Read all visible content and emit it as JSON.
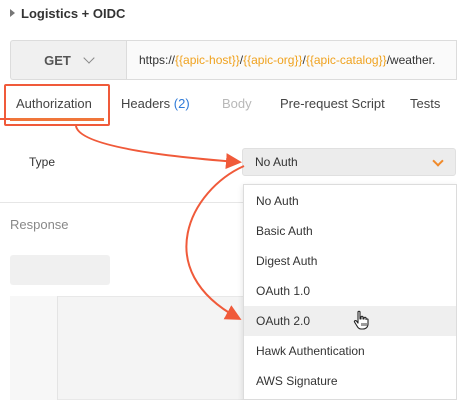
{
  "collection": {
    "title": "Logistics + OIDC"
  },
  "request": {
    "method": "GET",
    "url_segments": [
      {
        "text": "https://",
        "is_variable": false
      },
      {
        "text": "{{apic-host}}",
        "is_variable": true
      },
      {
        "text": "/",
        "is_variable": false
      },
      {
        "text": "{{apic-org}}",
        "is_variable": true
      },
      {
        "text": "/",
        "is_variable": false
      },
      {
        "text": "{{apic-catalog}}",
        "is_variable": true
      },
      {
        "text": "/weather.",
        "is_variable": false
      }
    ]
  },
  "tabs": {
    "authorization": "Authorization",
    "headers": "Headers",
    "headers_count": "(2)",
    "body": "Body",
    "prerequest": "Pre-request Script",
    "tests": "Tests"
  },
  "auth": {
    "type_label": "Type",
    "selected": "No Auth",
    "options": [
      "No Auth",
      "Basic Auth",
      "Digest Auth",
      "OAuth 1.0",
      "OAuth 2.0",
      "Hawk Authentication",
      "AWS Signature"
    ],
    "hovered_option": "OAuth 2.0"
  },
  "response": {
    "label": "Response"
  },
  "colors": {
    "variable": "#f0a21e",
    "annotation": "#f05a3a",
    "active_tab_underline": "#f0763a",
    "count": "#2f7ad8"
  },
  "icons": {
    "collapse": "triangle-right-icon",
    "method_dropdown": "chevron-down-icon",
    "type_dropdown": "chevron-down-icon",
    "cursor": "hand-pointer-icon"
  }
}
